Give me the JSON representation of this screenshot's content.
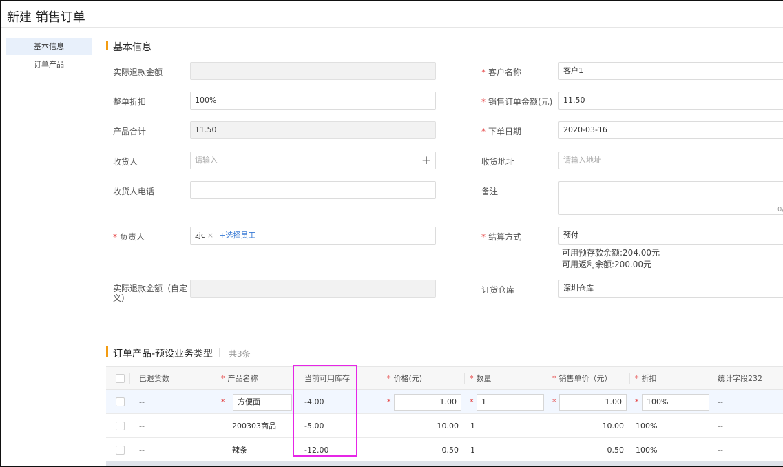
{
  "page": {
    "title": "新建 销售订单"
  },
  "sidebar": {
    "items": [
      {
        "label": "基本信息"
      },
      {
        "label": "订单产品"
      }
    ]
  },
  "basic": {
    "section_title": "基本信息",
    "left": {
      "actual_refund": {
        "label": "实际退款金额",
        "value": ""
      },
      "discount": {
        "label": "整单折扣",
        "value": "100%"
      },
      "product_total": {
        "label": "产品合计",
        "value": "11.50"
      },
      "receiver": {
        "label": "收货人",
        "placeholder": "请输入",
        "add_icon": "plus-icon"
      },
      "receiver_phone": {
        "label": "收货人电话",
        "value": ""
      },
      "owner": {
        "label": "负责人",
        "tag": "zjc",
        "tag_close": "×",
        "add_link": "+选择员工"
      },
      "actual_refund_custom": {
        "label": "实际退款金额（自定义）",
        "value": ""
      }
    },
    "right": {
      "customer": {
        "label": "客户名称",
        "value": "客户1"
      },
      "order_amount": {
        "label": "销售订单金额(元)",
        "value": "11.50"
      },
      "order_date": {
        "label": "下单日期",
        "value": "2020-03-16"
      },
      "address": {
        "label": "收货地址",
        "placeholder": "请输入地址"
      },
      "remark": {
        "label": "备注",
        "counter": "0/"
      },
      "settlement": {
        "label": "结算方式",
        "value": "预付",
        "prepaid_balance": "可用预存款余额:204.00元",
        "rebate_balance": "可用返利余额:200.00元"
      },
      "warehouse": {
        "label": "订货仓库",
        "value": "深圳仓库"
      }
    },
    "required_mark": "*"
  },
  "products": {
    "section_title": "订单产品-预设业务类型",
    "count": "共3条",
    "columns": [
      {
        "label": "已退货数",
        "required": false
      },
      {
        "label": "产品名称",
        "required": true
      },
      {
        "label": "当前可用库存",
        "required": false
      },
      {
        "label": "价格(元)",
        "required": true
      },
      {
        "label": "数量",
        "required": true
      },
      {
        "label": "销售单价（元）",
        "required": true
      },
      {
        "label": "折扣",
        "required": true
      },
      {
        "label": "统计字段232",
        "required": false
      }
    ],
    "rows": [
      {
        "returned": "--",
        "name": "方便面",
        "stock": "-4.00",
        "price": "1.00",
        "qty": "1",
        "unit_price": "1.00",
        "discount": "100%",
        "stat": "--",
        "editing": true
      },
      {
        "returned": "--",
        "name": "200303商品",
        "stock": "-5.00",
        "price": "10.00",
        "qty": "1",
        "unit_price": "10.00",
        "discount": "100%",
        "stat": "--",
        "editing": false
      },
      {
        "returned": "--",
        "name": "辣条",
        "stock": "-12.00",
        "price": "0.50",
        "qty": "1",
        "unit_price": "0.50",
        "discount": "100%",
        "stat": "--",
        "editing": false
      }
    ]
  },
  "colors": {
    "accent": "#f39c12",
    "required": "#e54040",
    "link": "#3a7bd5",
    "highlight": "#e626e6"
  }
}
